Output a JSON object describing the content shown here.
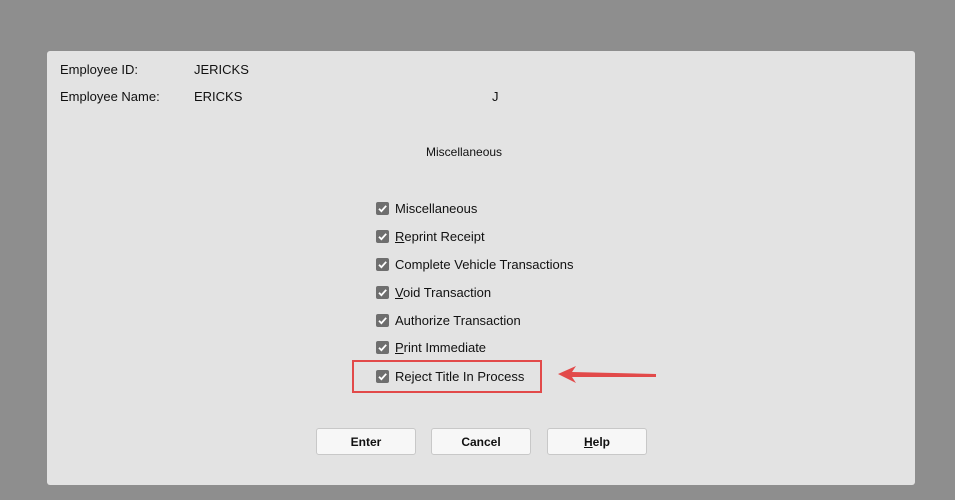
{
  "employee": {
    "id_label": "Employee ID:",
    "id_value": "JERICKS",
    "name_label": "Employee Name:",
    "name_value": "ERICKS",
    "middle_initial": "J"
  },
  "section_title": "Miscellaneous",
  "checkboxes": [
    {
      "label": "Miscellaneous",
      "mnemonic": "",
      "rest": "Miscellaneous",
      "checked": true
    },
    {
      "label": "Reprint Receipt",
      "mnemonic": "R",
      "rest": "eprint Receipt",
      "checked": true
    },
    {
      "label": "Complete Vehicle Transactions",
      "mnemonic": "",
      "rest": "Complete Vehicle Transactions",
      "checked": true
    },
    {
      "label": "Void Transaction",
      "mnemonic": "V",
      "rest": "oid Transaction",
      "checked": true
    },
    {
      "label": "Authorize Transaction",
      "mnemonic": "",
      "rest": "Authorize Transaction",
      "checked": true
    },
    {
      "label": "Print Immediate",
      "mnemonic": "P",
      "rest": "rint Immediate",
      "checked": true
    },
    {
      "label": "Reject Title In Process",
      "mnemonic": "",
      "rest": "Reject Title In Process",
      "checked": true
    }
  ],
  "buttons": {
    "enter": "Enter",
    "cancel": "Cancel",
    "help_mnemonic": "H",
    "help_rest": "elp"
  },
  "colors": {
    "annotation": "#e24a4a",
    "checkbox_fill": "#6e6e6e"
  }
}
